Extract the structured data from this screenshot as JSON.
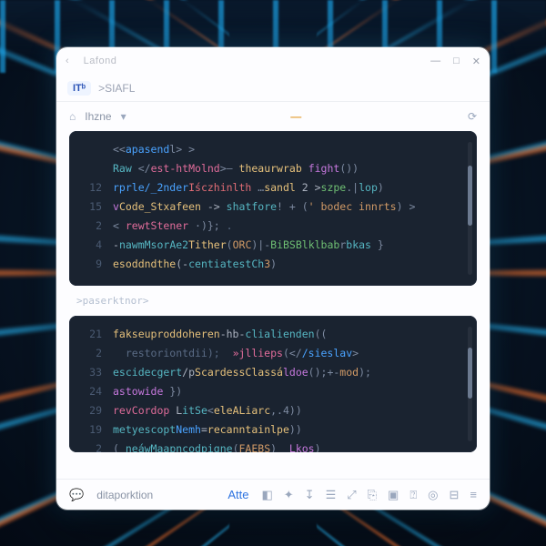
{
  "titlebar": {
    "back_glyph": "‹",
    "title": "Lafond"
  },
  "win_controls": {
    "min": "—",
    "max": "□",
    "close": "✕"
  },
  "toolbar": {
    "badge": "ITᵇ",
    "crumb": ">SIAFL"
  },
  "subbar": {
    "home_glyph": "⌂",
    "home_label": "Ihzne",
    "chevron": "▾",
    "dash": "—",
    "clock_glyph": "⟳"
  },
  "editor1": {
    "lines": [
      {
        "no": "",
        "tokens": [
          [
            "tk-punc",
            "<<"
          ],
          [
            "tk-tag",
            "apasend"
          ],
          [
            "tk-punc",
            "l> >"
          ]
        ]
      },
      {
        "no": "",
        "tokens": [
          [
            "tk-var",
            "Raw "
          ],
          [
            "tk-punc",
            "</"
          ],
          [
            "tk-pink",
            "est-htMolnd"
          ],
          [
            "tk-punc",
            ">— "
          ],
          [
            "tk-fn",
            "theaurwrab "
          ],
          [
            "tk-kw",
            "fight"
          ],
          [
            "tk-punc",
            "())"
          ]
        ]
      },
      {
        "no": "12",
        "tokens": [
          [
            "tk-tag",
            "rprle/_2nder"
          ],
          [
            "tk-red",
            "Iśczhinlth"
          ],
          [
            "tk-punc",
            " …"
          ],
          [
            "tk-fn",
            "sandl"
          ],
          [
            "tk-op",
            " 2 >"
          ],
          [
            "tk-str",
            "szpe"
          ],
          [
            "tk-punc",
            ".|"
          ],
          [
            "tk-var",
            "lop"
          ],
          [
            "tk-punc",
            ")"
          ]
        ]
      },
      {
        "no": "15",
        "tokens": [
          [
            "tk-kw",
            "v"
          ],
          [
            "tk-fn",
            "Code_Stxafeen"
          ],
          [
            "tk-op",
            " -> "
          ],
          [
            "tk-var",
            "shatfore"
          ],
          [
            "tk-punc",
            "! + ("
          ],
          [
            "tk-str2",
            "' bodec innrts"
          ],
          [
            "tk-punc",
            ") >"
          ]
        ]
      },
      {
        "no": "2",
        "tokens": [
          [
            "tk-punc",
            "< "
          ],
          [
            "tk-pink",
            "rewtStener"
          ],
          [
            "tk-punc",
            " ·)};"
          ],
          [
            "tk-com",
            " ."
          ]
        ]
      },
      {
        "no": "4",
        "tokens": [
          [
            "tk-op",
            "-"
          ],
          [
            "tk-var",
            "nawmMsorAe2"
          ],
          [
            "tk-fn",
            "Tither"
          ],
          [
            "tk-punc",
            "("
          ],
          [
            "tk-num",
            "ORC"
          ],
          [
            "tk-punc",
            ")|-"
          ],
          [
            "tk-str",
            "BiBSBlklbab"
          ],
          [
            "tk-punc",
            "r"
          ],
          [
            "tk-var",
            "bkas"
          ],
          [
            "tk-punc",
            " }"
          ]
        ]
      },
      {
        "no": "9",
        "tokens": [
          [
            "tk-fn",
            "esoddndthe"
          ],
          [
            "tk-op",
            "(-"
          ],
          [
            "tk-var",
            "centiatestCh"
          ],
          [
            "tk-num",
            "3"
          ],
          [
            "tk-punc",
            ")"
          ]
        ]
      }
    ]
  },
  "prompt1": ">paserktnor>",
  "editor2": {
    "lines": [
      {
        "no": "21",
        "tokens": [
          [
            "tk-fn",
            "fakseuproddoheren"
          ],
          [
            "tk-op",
            "-hb-"
          ],
          [
            "tk-var",
            "clialienden"
          ],
          [
            "tk-punc",
            "(("
          ]
        ]
      },
      {
        "no": "2",
        "tokens": [
          [
            "tk-com",
            "  restoriontdii);  "
          ],
          [
            "tk-pink",
            "»jllieps"
          ],
          [
            "tk-punc",
            "(</"
          ],
          [
            "tk-tag",
            "/sieslav"
          ],
          [
            "tk-punc",
            ">"
          ]
        ]
      },
      {
        "no": "33",
        "tokens": [
          [
            "tk-var",
            "escidecgert"
          ],
          [
            "tk-op",
            "/p"
          ],
          [
            "tk-fn",
            "ScardessClassá"
          ],
          [
            "tk-kw",
            "ldoe"
          ],
          [
            "tk-punc",
            "();+-"
          ],
          [
            "tk-str2",
            "mod"
          ],
          [
            "tk-punc",
            ");"
          ]
        ]
      },
      {
        "no": "24",
        "tokens": [
          [
            "tk-kw",
            "astowide"
          ],
          [
            "tk-punc",
            " })"
          ]
        ]
      },
      {
        "no": "29",
        "tokens": [
          [
            "tk-pink",
            "revCordop"
          ],
          [
            "tk-op",
            " L"
          ],
          [
            "tk-var",
            "itSe"
          ],
          [
            "tk-punc",
            "<"
          ],
          [
            "tk-fn",
            "eleALiarc"
          ],
          [
            "tk-punc",
            ",.4))"
          ]
        ]
      },
      {
        "no": "19",
        "tokens": [
          [
            "tk-var",
            "metyescopt"
          ],
          [
            "tk-tag",
            "Nemh"
          ],
          [
            "tk-op",
            "="
          ],
          [
            "tk-fn",
            "recanntainlpe"
          ],
          [
            "tk-punc",
            "))"
          ]
        ]
      },
      {
        "no": "2",
        "tokens": [
          [
            "tk-punc",
            "( "
          ],
          [
            "tk-var",
            "neáwMaapncodpigne"
          ],
          [
            "tk-punc",
            "("
          ],
          [
            "tk-num",
            "FAEBS"
          ],
          [
            "tk-punc",
            ")  "
          ],
          [
            "tk-kw",
            "Lkos"
          ],
          [
            "tk-punc",
            ")"
          ]
        ]
      }
    ]
  },
  "statusbar": {
    "label": "ditaporktion",
    "chat_glyph": "💬",
    "atte": "Atte",
    "icons": [
      "◧",
      "✦",
      "↧",
      "☰",
      "⤢",
      "⎘",
      "▣",
      "⍰",
      "◎",
      "⊟",
      "≡"
    ]
  }
}
